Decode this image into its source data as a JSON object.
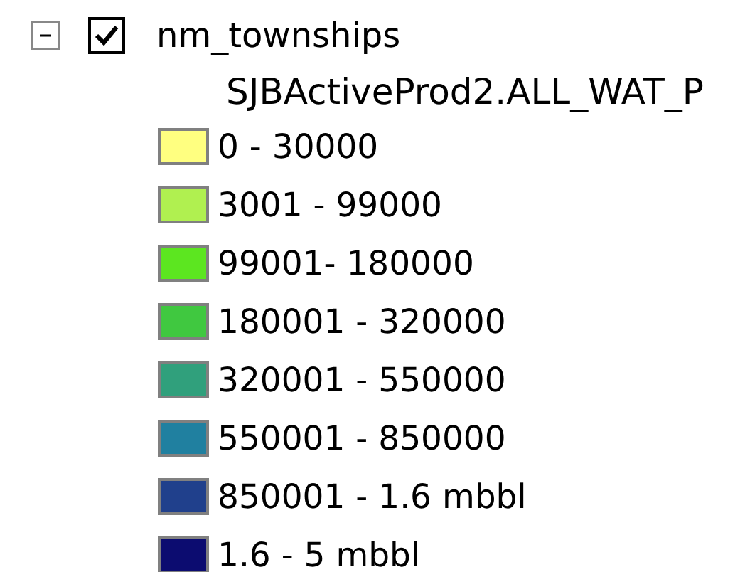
{
  "layer": {
    "name": "nm_townships",
    "expanded": true,
    "checked": true,
    "field": "SJBActiveProd2.ALL_WAT_P",
    "classes": [
      {
        "label": "0 - 30000",
        "color": "#ffff80"
      },
      {
        "label": "3001 - 99000",
        "color": "#b0f050"
      },
      {
        "label": "99001- 180000",
        "color": "#5ce620"
      },
      {
        "label": "180001 - 320000",
        "color": "#40c840"
      },
      {
        "label": "320001 - 550000",
        "color": "#30a07c"
      },
      {
        "label": "550001 - 850000",
        "color": "#2080a0"
      },
      {
        "label": "850001 - 1.6 mbbl",
        "color": "#20408c"
      },
      {
        "label": "1.6 - 5 mbbl",
        "color": "#0c0c70"
      }
    ]
  }
}
